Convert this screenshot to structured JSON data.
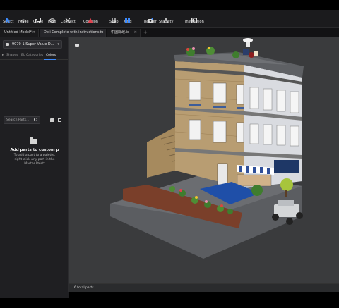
{
  "toolbar": {
    "items": [
      {
        "label": "Select",
        "icon": "cursor-icon"
      },
      {
        "label": "Hinge",
        "icon": "hinge-icon"
      },
      {
        "label": "Clone",
        "icon": "clone-icon"
      },
      {
        "label": "Hide",
        "icon": "eye-icon"
      },
      {
        "label": "Connect",
        "icon": "connect-icon"
      },
      {
        "label": "Collision",
        "icon": "warning-triangle-icon"
      },
      {
        "label": "Snap",
        "icon": "snap-icon"
      },
      {
        "label": "Grid",
        "icon": "grid-icon"
      },
      {
        "label": "Render",
        "icon": "camera-icon"
      },
      {
        "label": "Stability",
        "icon": "stability-icon"
      },
      {
        "label": "Instruction",
        "icon": "instruction-icon"
      }
    ],
    "accent": "#3d8bfd",
    "warning": "#e0424f"
  },
  "tabs": [
    {
      "label": "Untitled Model*"
    },
    {
      "label": "Deli Complete with instructions.io"
    },
    {
      "label": "中国邮政.io"
    }
  ],
  "tab_add_label": "+",
  "left_panel": {
    "palette_dropdown": "9070-1 Super Value D...",
    "subtabs": [
      "Shapes",
      "BL Categories",
      "Colors"
    ],
    "active_subtab": "Colors",
    "search_placeholder": "Search Parts...",
    "empty_title": "Add parts to custom p",
    "empty_text": "To add a part to a palette, right-click any part in the Master Palett"
  },
  "viewport": {
    "status": "6 total parts"
  }
}
